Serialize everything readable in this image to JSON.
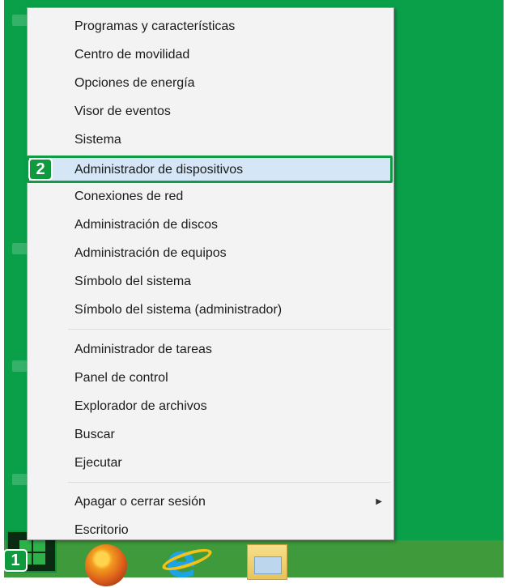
{
  "colors": {
    "desktop_green": "#0aa04a",
    "taskbar_green": "#3e9a3b",
    "menu_bg": "#f3f3f3",
    "selected_bg": "#d5e6f6",
    "annotation_green": "#0f9a3f"
  },
  "menu": {
    "group1": [
      "Programas y características",
      "Centro de movilidad",
      "Opciones de energía",
      "Visor de eventos",
      "Sistema",
      "Administrador de dispositivos",
      "Conexiones de red",
      "Administración de discos",
      "Administración de equipos",
      "Símbolo del sistema",
      "Símbolo del sistema (administrador)"
    ],
    "group2": [
      "Administrador de tareas",
      "Panel de control",
      "Explorador de archivos",
      "Buscar",
      "Ejecutar"
    ],
    "group3": [
      "Apagar o cerrar sesión",
      "Escritorio"
    ],
    "selected": "Administrador de dispositivos",
    "submenu_arrow": "▶"
  },
  "annotations": {
    "badge1": "1",
    "badge2": "2"
  },
  "taskbar": {
    "icons": [
      "windows-logo-icon",
      "firefox-icon",
      "internet-explorer-icon",
      "file-explorer-icon"
    ],
    "ie_glyph": "e"
  }
}
